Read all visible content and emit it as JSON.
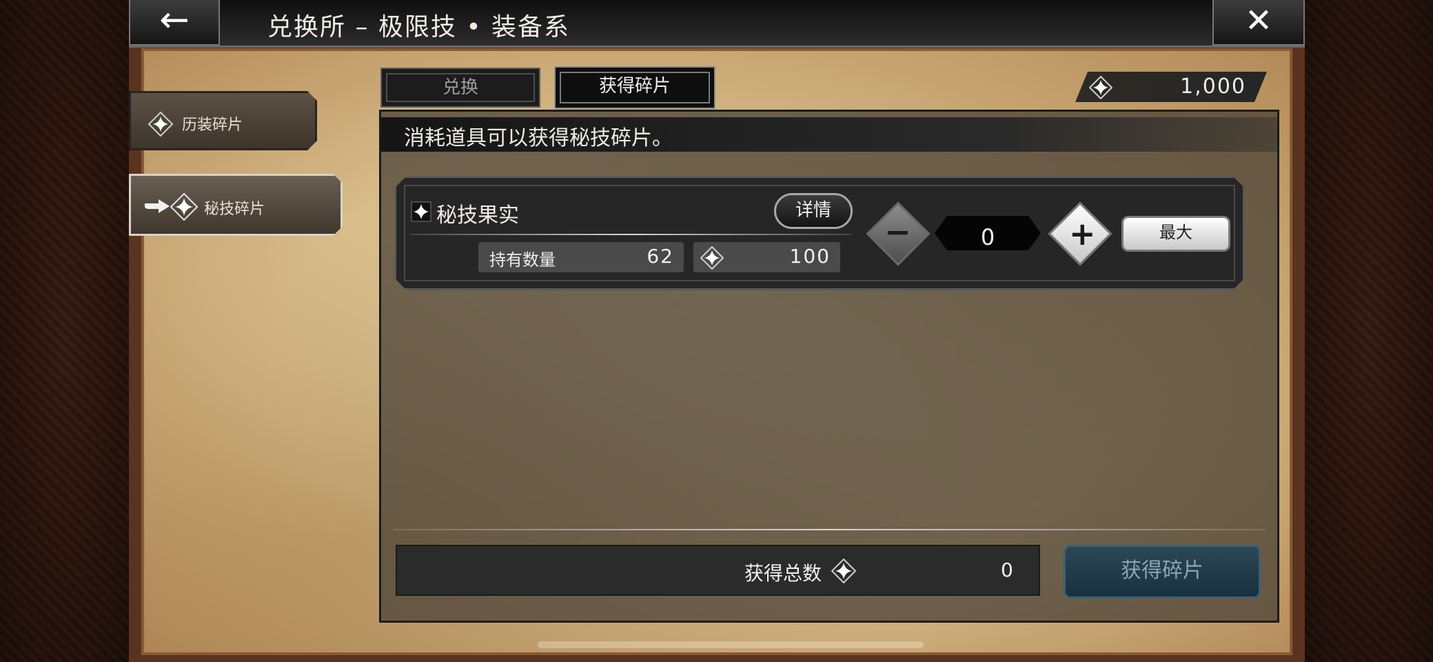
{
  "header": {
    "title": "兑换所 – 极限技 • 装备系",
    "back_icon": "←",
    "close_icon": "✕"
  },
  "tabs": [
    {
      "label": "兑换",
      "active": false
    },
    {
      "label": "获得碎片",
      "active": true
    }
  ],
  "currency": {
    "value": "1,000",
    "icon": "sparkle-diamond-icon"
  },
  "sidebar": {
    "items": [
      {
        "label": "历装碎片",
        "active": false
      },
      {
        "label": "秘技碎片",
        "active": true
      }
    ]
  },
  "description": "消耗道具可以获得秘技碎片。",
  "item": {
    "name": "秘技果实",
    "detail_label": "详情",
    "owned_label": "持有数量",
    "owned_value": "62",
    "shard_value": "100",
    "quantity": "0",
    "minus_symbol": "−",
    "plus_symbol": "+",
    "max_label": "最大"
  },
  "footer": {
    "total_label": "获得总数",
    "total_value": "0",
    "obtain_label": "获得碎片"
  },
  "colors": {
    "obtain_button": "#193040",
    "panel_dark": "#262626",
    "parchment": "#d8bc8a"
  }
}
